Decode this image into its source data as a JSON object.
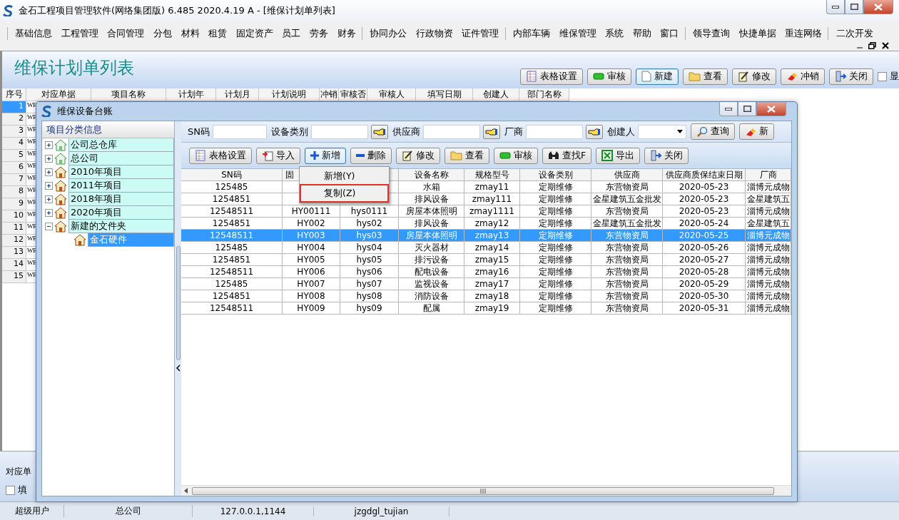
{
  "window": {
    "title": "金石工程项目管理软件(网络集团版) 6.485  2020.4.19 A - [维保计划单列表]"
  },
  "menu_groups": [
    [
      "基础信息",
      "工程管理",
      "合同管理",
      "分包",
      "材料",
      "租赁",
      "固定资产",
      "员工",
      "劳务",
      "财务"
    ],
    [
      "协同办公",
      "行政物资",
      "证件管理"
    ],
    [
      "内部车辆",
      "维保管理",
      "系统",
      "帮助",
      "窗口"
    ],
    [
      "领导查询",
      "快捷单据",
      "重连网络"
    ],
    [
      "二次开发"
    ]
  ],
  "page": {
    "title": "维保计划单列表",
    "toolbar": [
      {
        "label": "表格设置",
        "selected": false
      },
      {
        "label": "审核",
        "selected": false
      },
      {
        "label": "新建",
        "selected": true
      },
      {
        "label": "查看",
        "selected": false
      },
      {
        "label": "修改",
        "selected": false
      },
      {
        "label": "冲销",
        "selected": false
      },
      {
        "label": "关闭",
        "selected": false
      }
    ],
    "show_checkbox": {
      "label": "显",
      "checked": false
    }
  },
  "list": {
    "columns": [
      "序号",
      "对应单据",
      "项目名称",
      "计划年",
      "计划月",
      "计划说明",
      "冲销",
      "审核否",
      "审核人",
      "填写日期",
      "创建人",
      "部门名称"
    ],
    "rows": [
      {
        "no": "1",
        "doc": "WE",
        "selected": true
      },
      {
        "no": "2",
        "doc": "WE",
        "selected": false
      },
      {
        "no": "3",
        "doc": "WE",
        "selected": false
      },
      {
        "no": "4",
        "doc": "WE",
        "selected": false
      },
      {
        "no": "5",
        "doc": "WE",
        "selected": false
      },
      {
        "no": "6",
        "doc": "WE",
        "selected": false
      },
      {
        "no": "7",
        "doc": "WE",
        "selected": false
      },
      {
        "no": "8",
        "doc": "WE",
        "selected": false
      },
      {
        "no": "9",
        "doc": "WE",
        "selected": false
      },
      {
        "no": "10",
        "doc": "WE",
        "selected": false
      },
      {
        "no": "11",
        "doc": "WE",
        "selected": false
      },
      {
        "no": "12",
        "doc": "WE",
        "selected": false
      },
      {
        "no": "13",
        "doc": "WE",
        "selected": false
      },
      {
        "no": "14",
        "doc": "WE",
        "selected": false
      },
      {
        "no": "15",
        "doc": "WE",
        "selected": false
      }
    ]
  },
  "footer": {
    "label": "对应单",
    "checkbox": {
      "label": "填",
      "checked": false
    }
  },
  "status_bar": [
    "超级用户",
    "总公司",
    "127.0.0.1,1144",
    "jzgdgl_tujian"
  ],
  "dialog": {
    "title": "维保设备台账",
    "tree": {
      "title": "项目分类信息",
      "items": [
        {
          "label": "公司总仓库",
          "expanded": false,
          "selected": false
        },
        {
          "label": "总公司",
          "expanded": false,
          "selected": false
        },
        {
          "label": "2010年项目",
          "expanded": false,
          "selected": false
        },
        {
          "label": "2011年项目",
          "expanded": false,
          "selected": false
        },
        {
          "label": "2018年项目",
          "expanded": false,
          "selected": false
        },
        {
          "label": "2020年项目",
          "expanded": false,
          "selected": false
        },
        {
          "label": "新建的文件夹",
          "expanded": true,
          "selected": false,
          "children": [
            {
              "label": "金石硬件",
              "selected": true
            }
          ]
        }
      ]
    },
    "filters": [
      {
        "label": "SN码",
        "kind": "text"
      },
      {
        "label": "设备类别",
        "kind": "picker"
      },
      {
        "label": "供应商",
        "kind": "picker"
      },
      {
        "label": "厂商",
        "kind": "picker"
      },
      {
        "label": "创建人",
        "kind": "dropdown"
      }
    ],
    "filter_buttons": [
      "查询",
      "新"
    ],
    "toolbar": [
      {
        "label": "表格设置",
        "selected": false
      },
      {
        "label": "导入",
        "selected": false
      },
      {
        "label": "新增",
        "selected": true
      },
      {
        "label": "删除",
        "selected": false
      },
      {
        "label": "修改",
        "selected": false
      },
      {
        "label": "查看",
        "selected": false
      },
      {
        "label": "审核",
        "selected": false
      },
      {
        "label": "查找F",
        "selected": false
      },
      {
        "label": "导出",
        "selected": false
      },
      {
        "label": "关闭",
        "selected": false
      }
    ],
    "table": {
      "columns": [
        "SN码",
        "固",
        null,
        "设备名称",
        "规格型号",
        "设备类别",
        "供应商",
        "供应商质保结束日期",
        "厂商"
      ],
      "rows": [
        {
          "selected": false,
          "cells": [
            "125485",
            null,
            null,
            "水箱",
            "zmay11",
            "定期维修",
            "东营物资局",
            "2020-05-23",
            "淄博元成物"
          ]
        },
        {
          "selected": false,
          "cells": [
            "1254851",
            null,
            null,
            "排风设备",
            "zmay111",
            "定期维修",
            "金星建筑五金批发",
            "2020-05-23",
            "金星建筑五"
          ]
        },
        {
          "selected": false,
          "cells": [
            "12548511",
            "HY00111",
            "hys0111",
            "房屋本体照明",
            "zmay1111",
            "定期维修",
            "东营物资局",
            "2020-05-23",
            "淄博元成物"
          ]
        },
        {
          "selected": false,
          "cells": [
            "1254851",
            "HY002",
            "hys02",
            "排风设备",
            "zmay12",
            "定期维修",
            "金星建筑五金批发",
            "2020-05-24",
            "金星建筑五"
          ]
        },
        {
          "selected": true,
          "cells": [
            "12548511",
            "HY003",
            "hys03",
            "房屋本体照明",
            "zmay13",
            "定期维修",
            "东营物资局",
            "2020-05-25",
            "淄博元成物"
          ]
        },
        {
          "selected": false,
          "cells": [
            "125485",
            "HY004",
            "hys04",
            "灭火器材",
            "zmay14",
            "定期维修",
            "东营物资局",
            "2020-05-26",
            "淄博元成物"
          ]
        },
        {
          "selected": false,
          "cells": [
            "1254851",
            "HY005",
            "hys05",
            "排污设备",
            "zmay15",
            "定期维修",
            "东营物资局",
            "2020-05-27",
            "淄博元成物"
          ]
        },
        {
          "selected": false,
          "cells": [
            "12548511",
            "HY006",
            "hys06",
            "配电设备",
            "zmay16",
            "定期维修",
            "东营物资局",
            "2020-05-28",
            "淄博元成物"
          ]
        },
        {
          "selected": false,
          "cells": [
            "125485",
            "HY007",
            "hys07",
            "监视设备",
            "zmay17",
            "定期维修",
            "东营物资局",
            "2020-05-29",
            "淄博元成物"
          ]
        },
        {
          "selected": false,
          "cells": [
            "1254851",
            "HY008",
            "hys08",
            "消防设备",
            "zmay18",
            "定期维修",
            "东营物资局",
            "2020-05-30",
            "淄博元成物"
          ]
        },
        {
          "selected": false,
          "cells": [
            "12548511",
            "HY009",
            "hys09",
            "配属",
            "zmay19",
            "定期维修",
            "东营物资局",
            "2020-05-31",
            "淄博元成物"
          ]
        }
      ]
    },
    "context_menu": [
      {
        "label": "新增(Y)",
        "outlined": false
      },
      {
        "label": "复制(Z)",
        "outlined": true
      }
    ]
  }
}
